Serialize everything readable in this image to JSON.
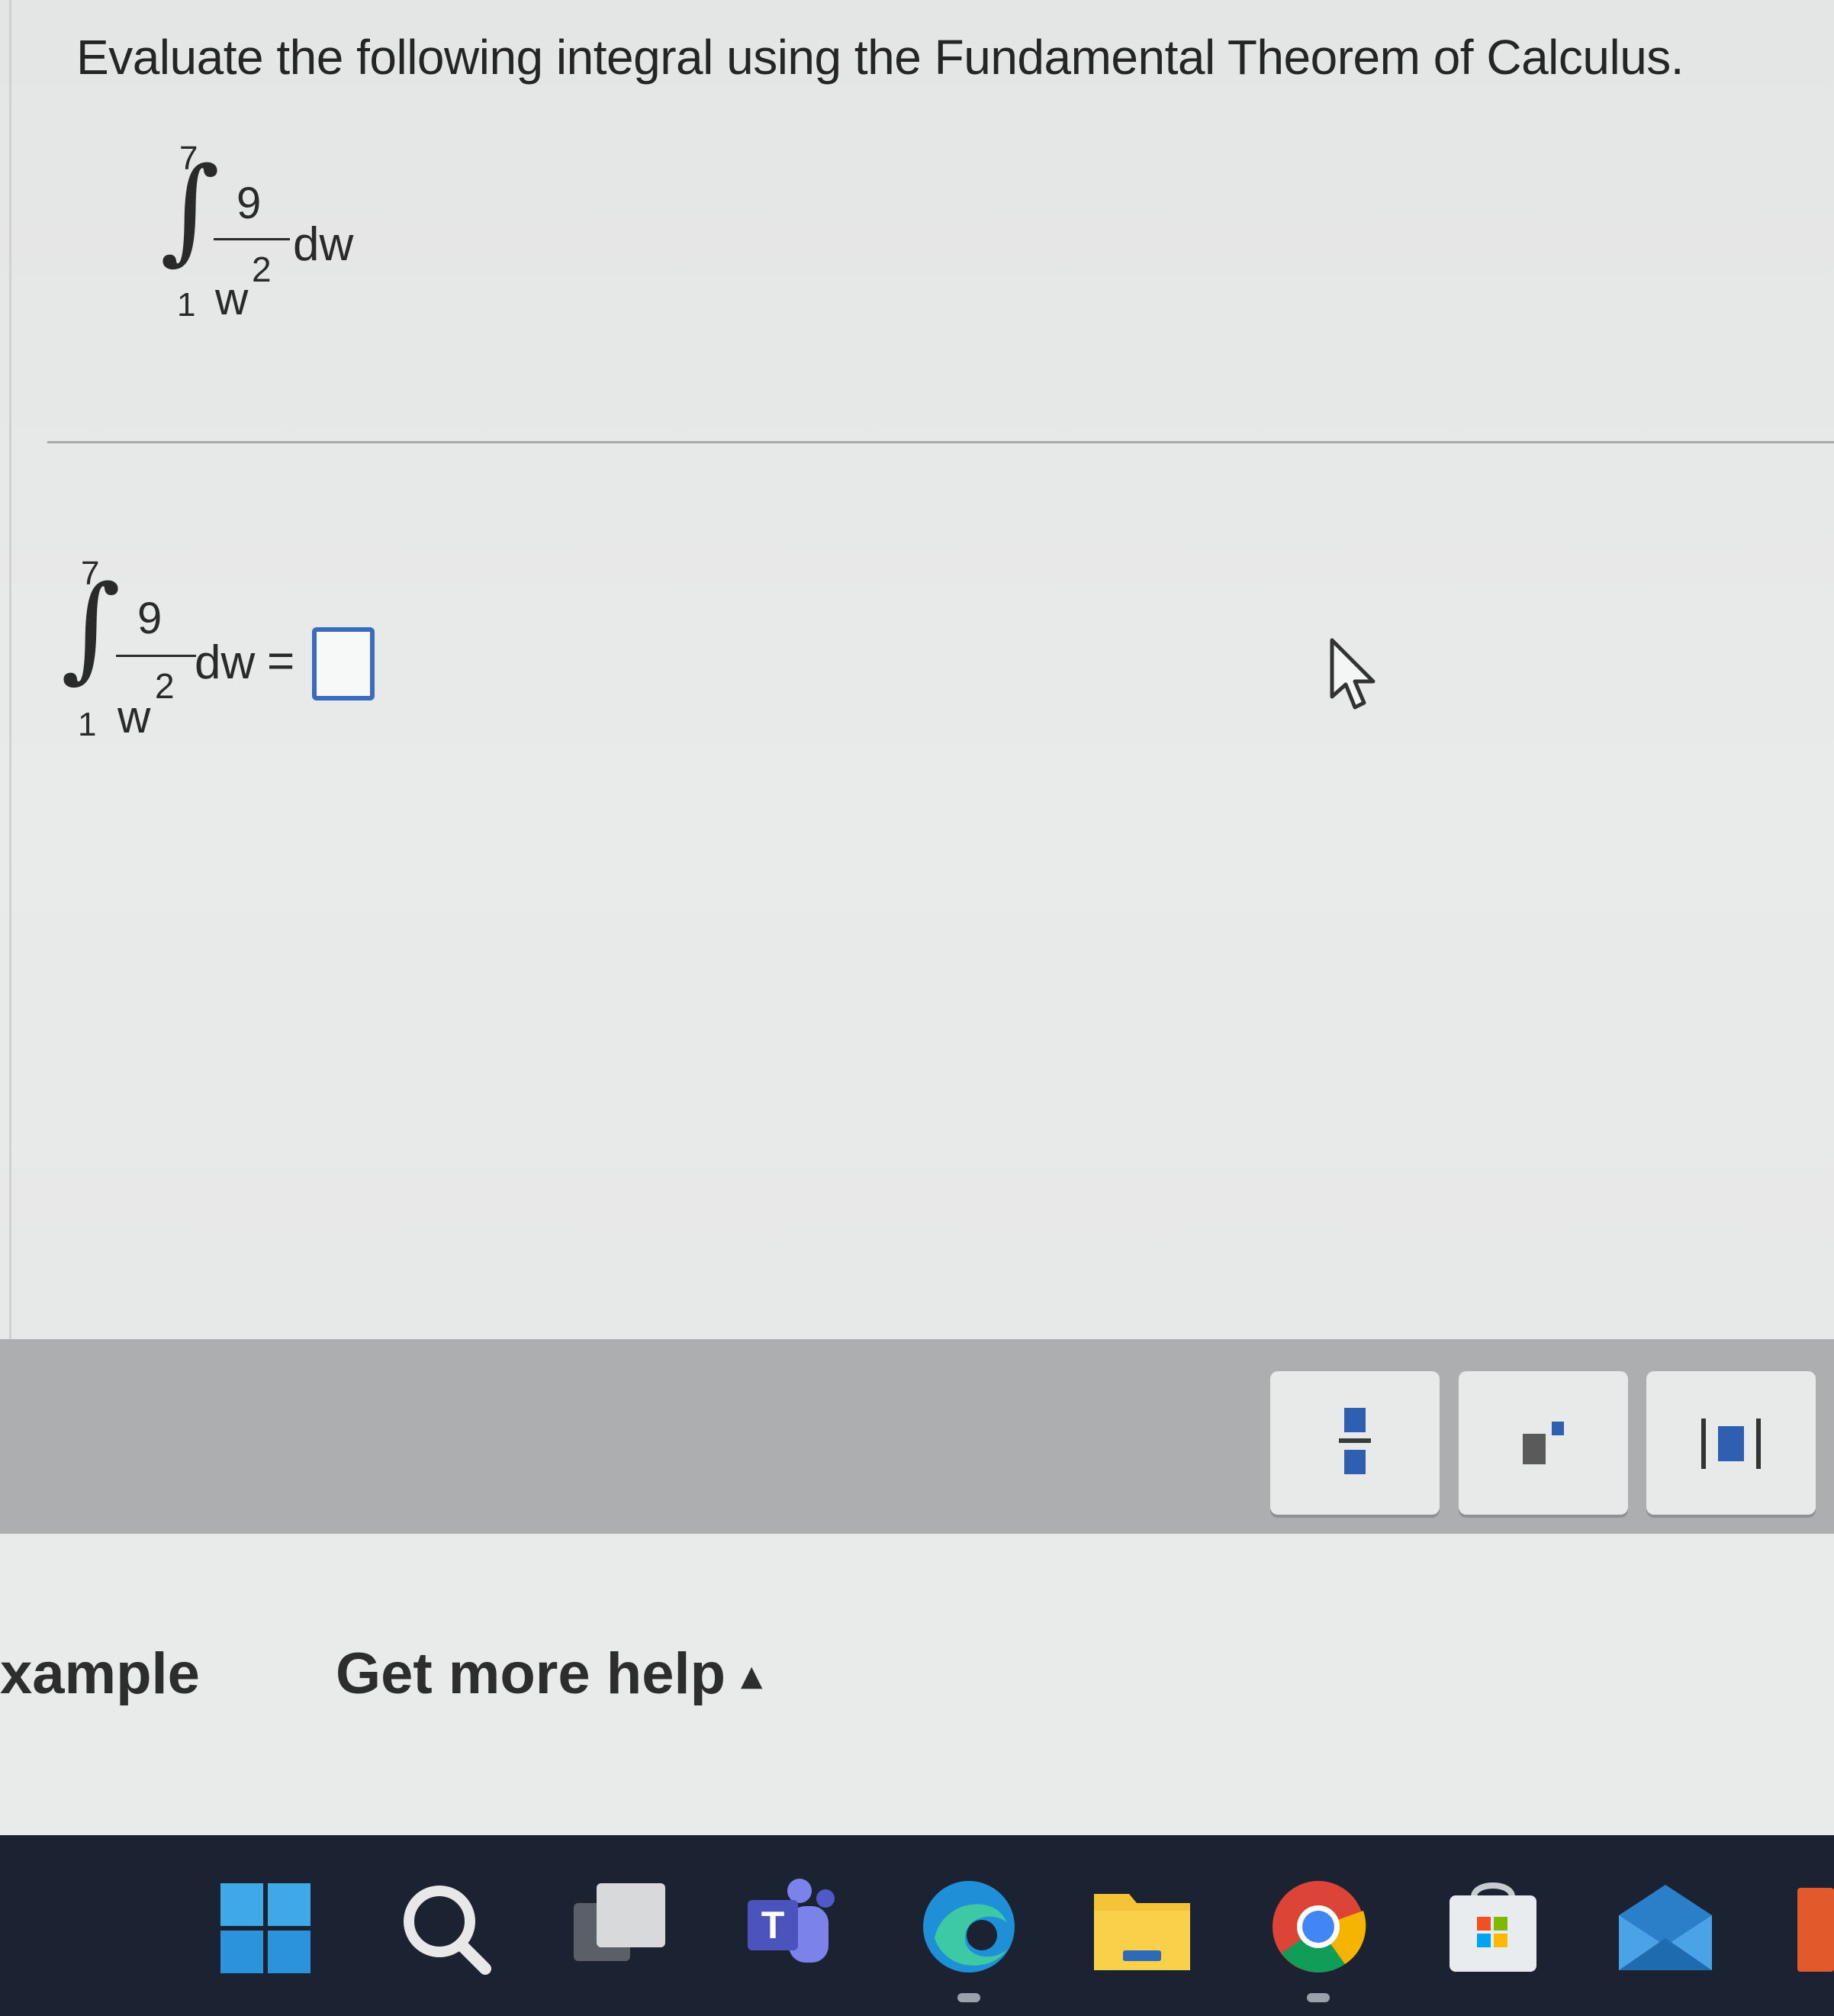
{
  "question": {
    "prompt": "Evaluate the following integral using the Fundamental Theorem of Calculus."
  },
  "integral": {
    "upper": "7",
    "lower": "1",
    "numerator": "9",
    "denominator": "w",
    "exponent": "2",
    "differential": "dw"
  },
  "answer_row": {
    "equals": "=",
    "answer_value": ""
  },
  "toolbar": {
    "buttons": [
      "fraction-icon",
      "superscript-icon",
      "absolute-value-icon"
    ]
  },
  "footer": {
    "example_label": "xample",
    "help_label": "Get more help",
    "help_arrow": "▴"
  },
  "taskbar": {
    "icons": [
      "windows-start-icon",
      "search-icon",
      "task-view-icon",
      "teams-icon",
      "edge-icon",
      "file-explorer-icon",
      "chrome-icon",
      "microsoft-store-icon",
      "mail-icon",
      "office-icon"
    ],
    "colors": {
      "accent": "#3b6bbf",
      "taskbar": "#1b2231"
    }
  }
}
